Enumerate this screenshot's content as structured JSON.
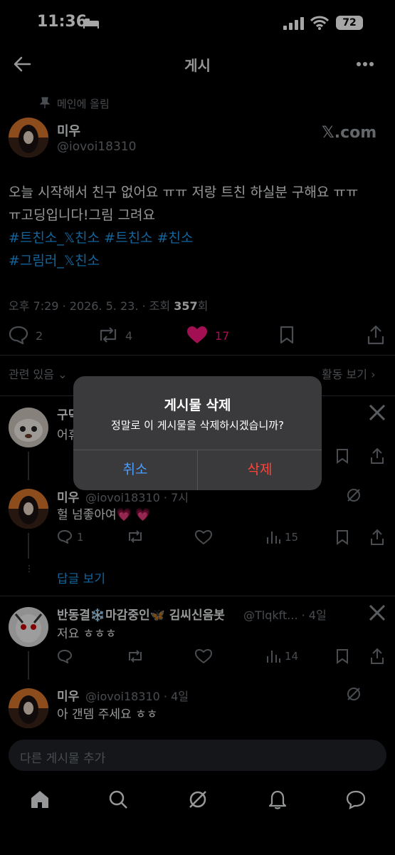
{
  "status_bar": {
    "time": "11:36",
    "battery": "72"
  },
  "header": {
    "title": "게시"
  },
  "post": {
    "pinned_label": "메인에 올림",
    "author_name": "미우",
    "author_handle": "@iovoi18310",
    "badge": "𝕏.com",
    "text_line1": "오늘 시작해서 친구 없어요 ㅠㅠ 저랑 트친 하실분 구해요 ㅠㅠ",
    "text_line2": "ㅠ고딩입니다!그림 그려요",
    "hashtags_line1": "#트친소_𝕏친소 #트친소 #친소",
    "hashtags_line2": "#그림러_𝕏친소",
    "meta_time": "오후 7:29 · 2026. 5. 23. · 조회",
    "meta_views": "357",
    "meta_views_suffix": "회",
    "replies": "2",
    "reposts": "4",
    "likes": "17",
    "like_color": "#f91880"
  },
  "related": {
    "label": "관련 있음",
    "activity_label": "활동 보기"
  },
  "replies": [
    {
      "name": "구덕",
      "text": "어휴"
    },
    {
      "name": "미우",
      "handle": "@iovoi18310 · 7시",
      "text": "헐 넘좋아여💗 💗",
      "replies": "1",
      "views": "15"
    },
    {
      "name": "반동결❄️마감중인🦋 김씨신음봇",
      "handle": "@Tlqkft... · 4일",
      "text": "저요 ㅎㅎㅎ",
      "views": "14"
    },
    {
      "name": "미우",
      "handle": "@iovoi18310 · 4일",
      "text": "아 갠뎀 주세요 ㅎㅎ"
    }
  ],
  "show_replies": "답글 보기",
  "dialog": {
    "title": "게시물 삭제",
    "message": "정말로 이 게시물을 삭제하시겠습니까?",
    "cancel": "취소",
    "delete": "삭제",
    "cancel_color": "#4a9cff",
    "delete_color": "#ff453a"
  },
  "composer": {
    "placeholder": "다른 게시물 추가"
  },
  "tabbar": [
    "home-icon",
    "search-icon",
    "grok-icon",
    "notifications-icon",
    "messages-icon"
  ]
}
